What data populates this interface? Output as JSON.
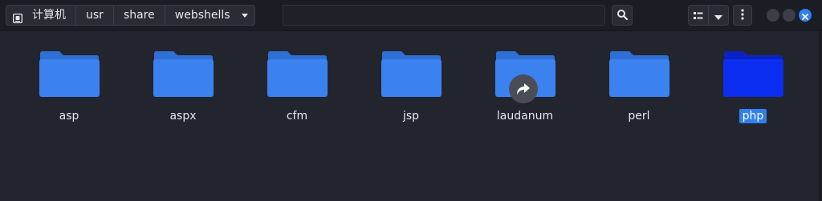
{
  "breadcrumbs": {
    "items": [
      {
        "label": "计算机",
        "icon": "drive-icon"
      },
      {
        "label": "usr"
      },
      {
        "label": "share"
      },
      {
        "label": "webshells",
        "has_dropdown": true
      }
    ]
  },
  "path_field": {
    "value": ""
  },
  "toolbar": {
    "search_icon": "search-icon",
    "view_icon": "list-view-icon",
    "view_dropdown_icon": "chevron-down-icon",
    "menu_icon": "kebab-menu-icon"
  },
  "window_controls": {
    "minimize": "minimize-button",
    "maximize": "maximize-button",
    "close": "close-button"
  },
  "files": [
    {
      "name": "asp",
      "type": "folder",
      "selected": false,
      "symlink": false
    },
    {
      "name": "aspx",
      "type": "folder",
      "selected": false,
      "symlink": false
    },
    {
      "name": "cfm",
      "type": "folder",
      "selected": false,
      "symlink": false
    },
    {
      "name": "jsp",
      "type": "folder",
      "selected": false,
      "symlink": false
    },
    {
      "name": "laudanum",
      "type": "folder",
      "selected": false,
      "symlink": true
    },
    {
      "name": "perl",
      "type": "folder",
      "selected": false,
      "symlink": false
    },
    {
      "name": "php",
      "type": "folder",
      "selected": true,
      "symlink": false
    }
  ],
  "colors": {
    "folder": "#3b82f0",
    "folder_tab": "#2f6fd6",
    "folder_selected": "#0b2ef0",
    "folder_selected_tab": "#0a22c4",
    "selection": "#2f80ed",
    "background": "#23252e",
    "header": "#1b1d24"
  }
}
